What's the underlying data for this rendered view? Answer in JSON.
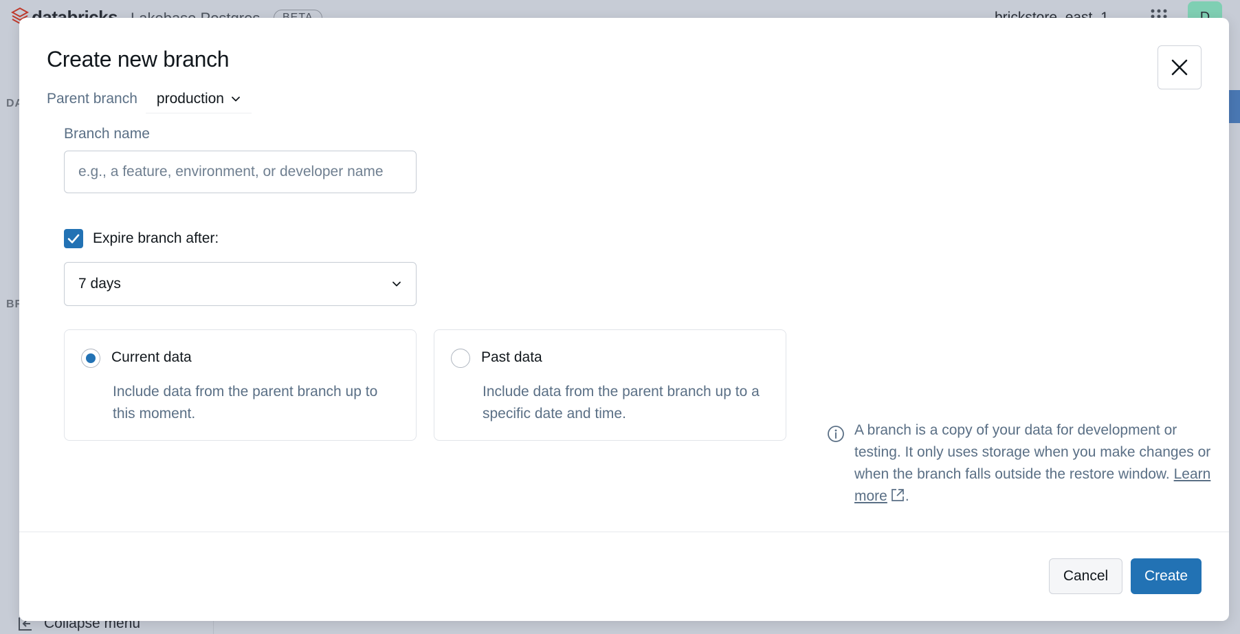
{
  "background": {
    "brand": "databricks",
    "product": "Lakebase Postgres",
    "beta_badge": "BETA",
    "workspace": "brickstore_east_1",
    "avatar_initial": "D",
    "sidebar_section_1": "DA",
    "sidebar_section_2": "BR",
    "collapse_menu": "Collapse menu"
  },
  "dialog": {
    "title": "Create new branch",
    "parent_branch_label": "Parent branch",
    "parent_branch_value": "production",
    "branch_name_label": "Branch name",
    "branch_name_value": "",
    "branch_name_placeholder": "e.g., a feature, environment, or developer name",
    "expire_label": "Expire branch after:",
    "expire_checked": true,
    "expire_value": "7 days",
    "data_options": [
      {
        "title": "Current data",
        "description": "Include data from the parent branch up to this moment.",
        "selected": true
      },
      {
        "title": "Past data",
        "description": "Include data from the parent branch up to a specific date and time.",
        "selected": false
      }
    ],
    "info_text": "A branch is a copy of your data for development or testing. It only uses storage when you make changes or when the branch falls outside the restore window.",
    "learn_more": "Learn more",
    "info_suffix": ".",
    "cancel_label": "Cancel",
    "create_label": "Create"
  },
  "colors": {
    "primary": "#2272b4",
    "text": "#11171c",
    "secondary_text": "#5a6f85",
    "border": "#c6ccd4",
    "overlay": "#c7ccd6"
  },
  "icons": {
    "close": "close-icon",
    "chevron": "chevron-down-icon",
    "check": "check-icon",
    "info": "info-icon",
    "external": "external-link-icon"
  }
}
